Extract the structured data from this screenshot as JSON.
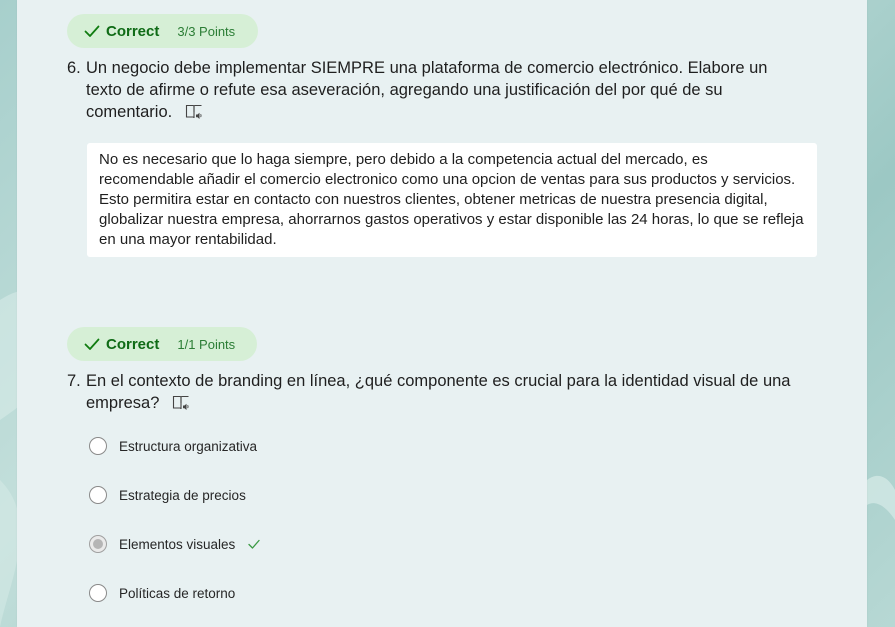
{
  "colors": {
    "panel_bg": "#e8f1f2",
    "badge_bg": "#d6efd6",
    "correct_text": "#0f6b16",
    "answer_bg": "#ffffff"
  },
  "q6": {
    "badge": {
      "label": "Correct",
      "points": "3/3 Points"
    },
    "number": "6.",
    "text": "Un negocio debe implementar SIEMPRE una plataforma de comercio electrónico. Elabore un texto de afirme o refute esa aseveración, agregando una justificación del por qué de su comentario.",
    "answer": "No es necesario que lo haga siempre, pero debido a la competencia actual del mercado, es recomendable añadir el comercio electronico como una opcion de ventas para sus productos y servicios. Esto permitira estar en contacto con nuestros clientes, obtener metricas de nuestra presencia digital, globalizar nuestra empresa, ahorrarnos gastos operativos y estar disponible las 24 horas, lo que se refleja en una mayor rentabilidad."
  },
  "q7": {
    "badge": {
      "label": "Correct",
      "points": "1/1 Points"
    },
    "number": "7.",
    "text": "En el contexto de branding en línea, ¿qué componente es crucial para la identidad visual de una empresa?",
    "options": [
      {
        "label": "Estructura organizativa",
        "selected": false,
        "correct": false
      },
      {
        "label": "Estrategia de precios",
        "selected": false,
        "correct": false
      },
      {
        "label": "Elementos visuales",
        "selected": true,
        "correct": true
      },
      {
        "label": "Políticas de retorno",
        "selected": false,
        "correct": false
      }
    ]
  },
  "icons": {
    "badge_check": "checkmark-icon",
    "immersive_reader": "immersive-reader-icon",
    "option_correct": "checkmark-icon"
  }
}
